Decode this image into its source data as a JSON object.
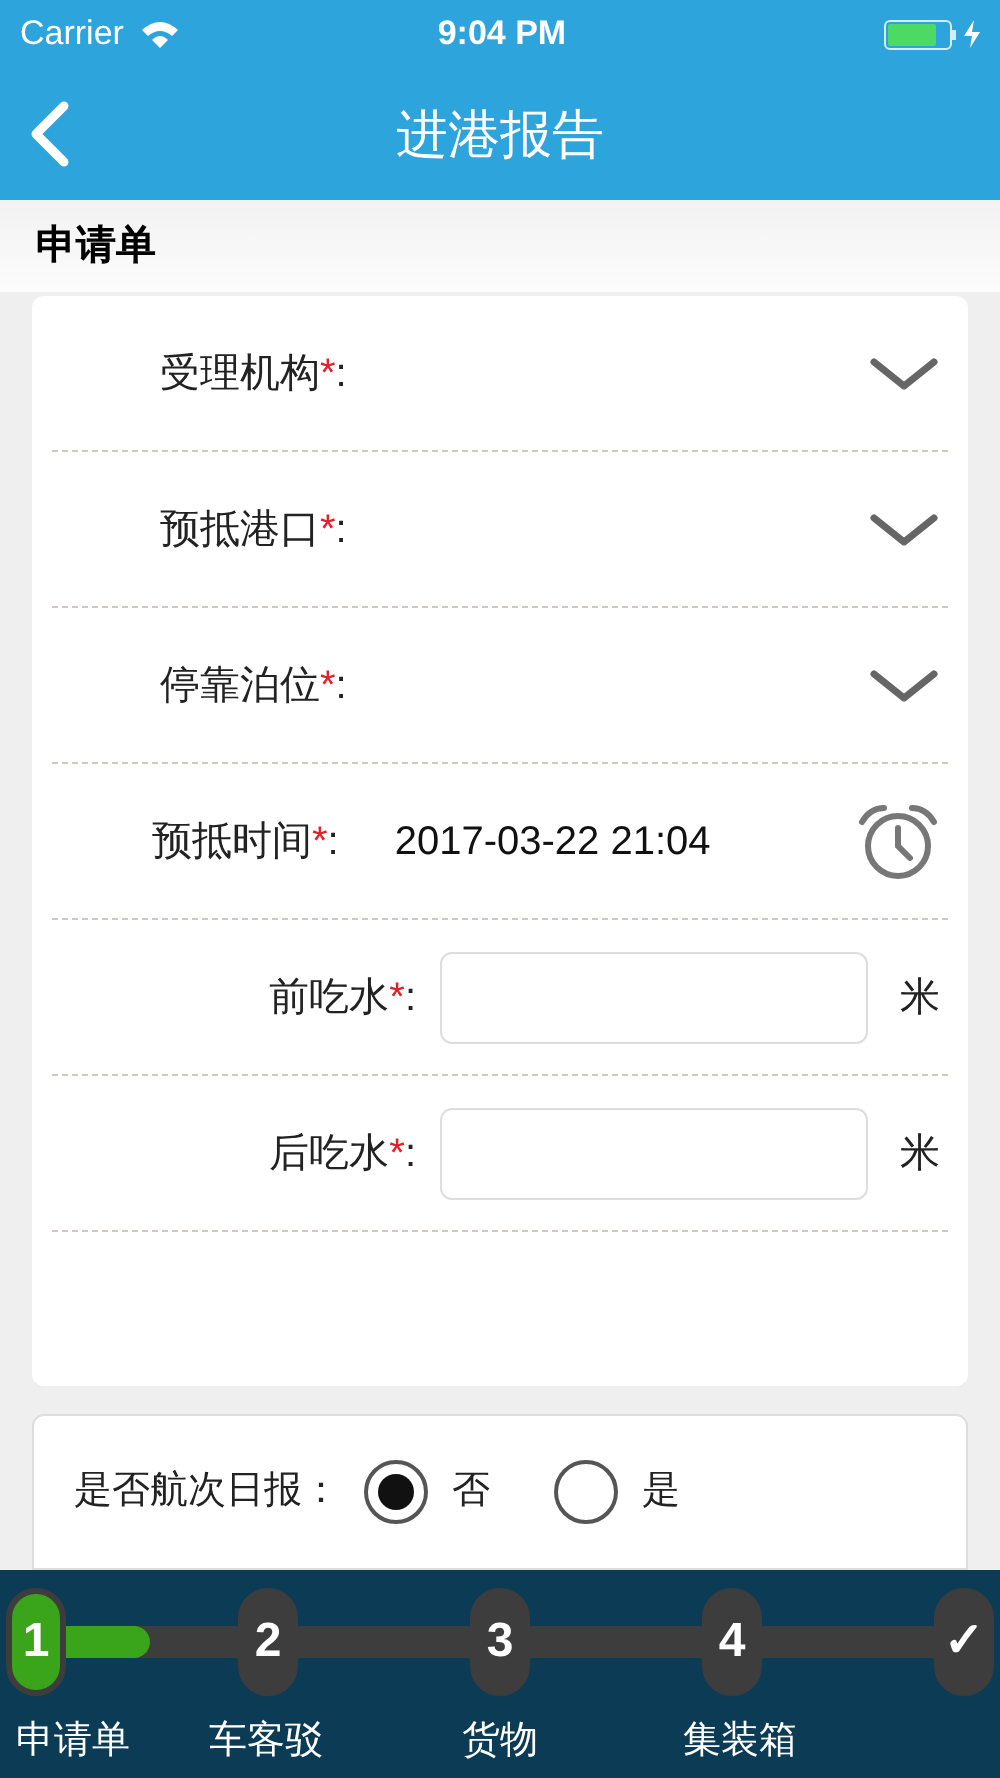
{
  "status_bar": {
    "carrier": "Carrier",
    "time": "9:04 PM"
  },
  "nav": {
    "title": "进港报告"
  },
  "section": {
    "title": "申请单"
  },
  "fields": [
    {
      "kind": "select",
      "label": "受理机构",
      "mark": "*",
      "colon": ":"
    },
    {
      "kind": "select",
      "label": "预抵港口",
      "mark": "*",
      "colon": ":"
    },
    {
      "kind": "select",
      "label": "停靠泊位",
      "mark": "*",
      "colon": ":"
    },
    {
      "kind": "datetime",
      "label": "预抵时间",
      "mark": "*",
      "colon": ":",
      "value": "2017-03-22 21:04"
    },
    {
      "kind": "input",
      "label": "前吃水",
      "mark": "*",
      "colon": ":",
      "unit": "米"
    },
    {
      "kind": "input",
      "label": "后吃水",
      "mark": "*",
      "colon": ":",
      "unit": "米"
    }
  ],
  "daily_report": {
    "label": "是否航次日报：",
    "options": [
      {
        "label": "否",
        "selected": true
      },
      {
        "label": "是",
        "selected": false
      }
    ]
  },
  "steps": {
    "level": 0.13,
    "items": [
      {
        "number": "1",
        "label": "申请单",
        "selected": true
      },
      {
        "number": "2",
        "label": "车客驳",
        "selected": false
      },
      {
        "number": "3",
        "label": "货物",
        "selected": false
      },
      {
        "number": "4",
        "label": "集装箱",
        "selected": false
      },
      {
        "number": "✓",
        "selected": false
      }
    ]
  }
}
